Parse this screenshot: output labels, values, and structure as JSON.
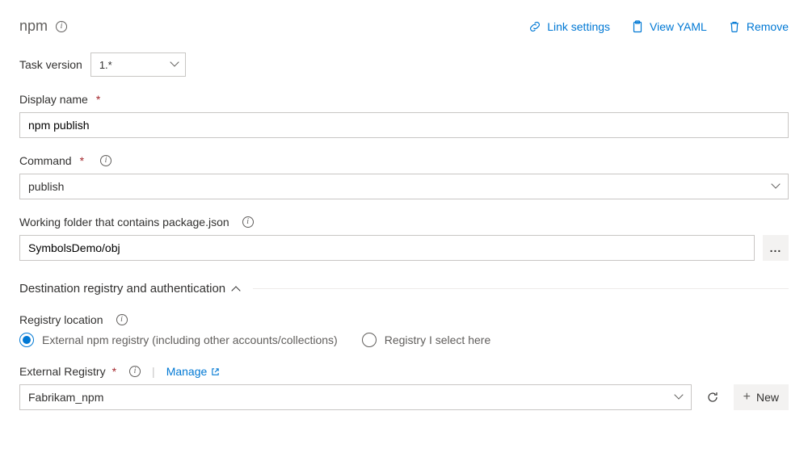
{
  "header": {
    "title": "npm",
    "actions": {
      "link_settings": "Link settings",
      "view_yaml": "View YAML",
      "remove": "Remove"
    }
  },
  "task_version": {
    "label": "Task version",
    "value": "1.*"
  },
  "display_name": {
    "label": "Display name",
    "value": "npm publish"
  },
  "command": {
    "label": "Command",
    "value": "publish"
  },
  "working_folder": {
    "label": "Working folder that contains package.json",
    "value": "SymbolsDemo/obj"
  },
  "section": {
    "title": "Destination registry and authentication"
  },
  "registry_location": {
    "label": "Registry location",
    "options": {
      "external": "External npm registry (including other accounts/collections)",
      "select_here": "Registry I select here"
    },
    "selected": "external"
  },
  "external_registry": {
    "label": "External Registry",
    "manage": "Manage",
    "value": "Fabrikam_npm",
    "new_button": "New"
  },
  "browse_label": "..."
}
